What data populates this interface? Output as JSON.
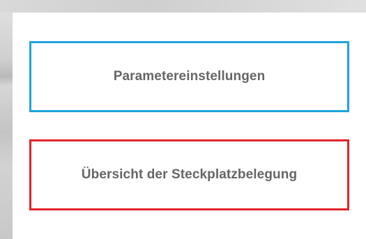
{
  "menu": {
    "items": [
      {
        "label": "Parametereinstellungen",
        "border_color": "#1fa3dc"
      },
      {
        "label": "Übersicht der Steckplatzbelegung",
        "border_color": "#e2222c"
      }
    ]
  },
  "colors": {
    "panel_background": "#ffffff",
    "label_text": "#666666",
    "frame_gray": "#cfcfcf"
  }
}
